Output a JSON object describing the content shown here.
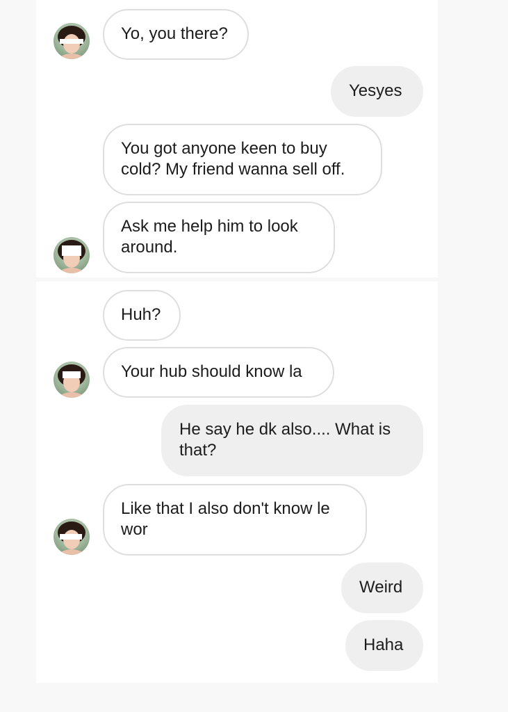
{
  "chat": {
    "messages": [
      {
        "sender": "them",
        "text": "Yo, you there?"
      },
      {
        "sender": "me",
        "text": "Yesyes"
      },
      {
        "sender": "them",
        "text": "You got anyone keen to buy cold? My friend wanna sell off."
      },
      {
        "sender": "them",
        "text": "Ask me help him to look around."
      },
      {
        "sender": "them",
        "text": "Huh?"
      },
      {
        "sender": "them",
        "text": "Your hub should know la"
      },
      {
        "sender": "me",
        "text": "He say he dk also.... What is that?"
      },
      {
        "sender": "them",
        "text": "Like that I also don't know le wor"
      },
      {
        "sender": "me",
        "text": "Weird"
      },
      {
        "sender": "me",
        "text": "Haha"
      }
    ]
  },
  "colors": {
    "page_background": "#f8f8f8",
    "panel_background": "#ffffff",
    "incoming_bubble_border": "#dedede",
    "outgoing_bubble_fill": "#efefef",
    "text": "#1c1c1c"
  },
  "icons": {
    "contact_avatar": "contact-avatar-photo",
    "redaction": "redaction-bar"
  }
}
